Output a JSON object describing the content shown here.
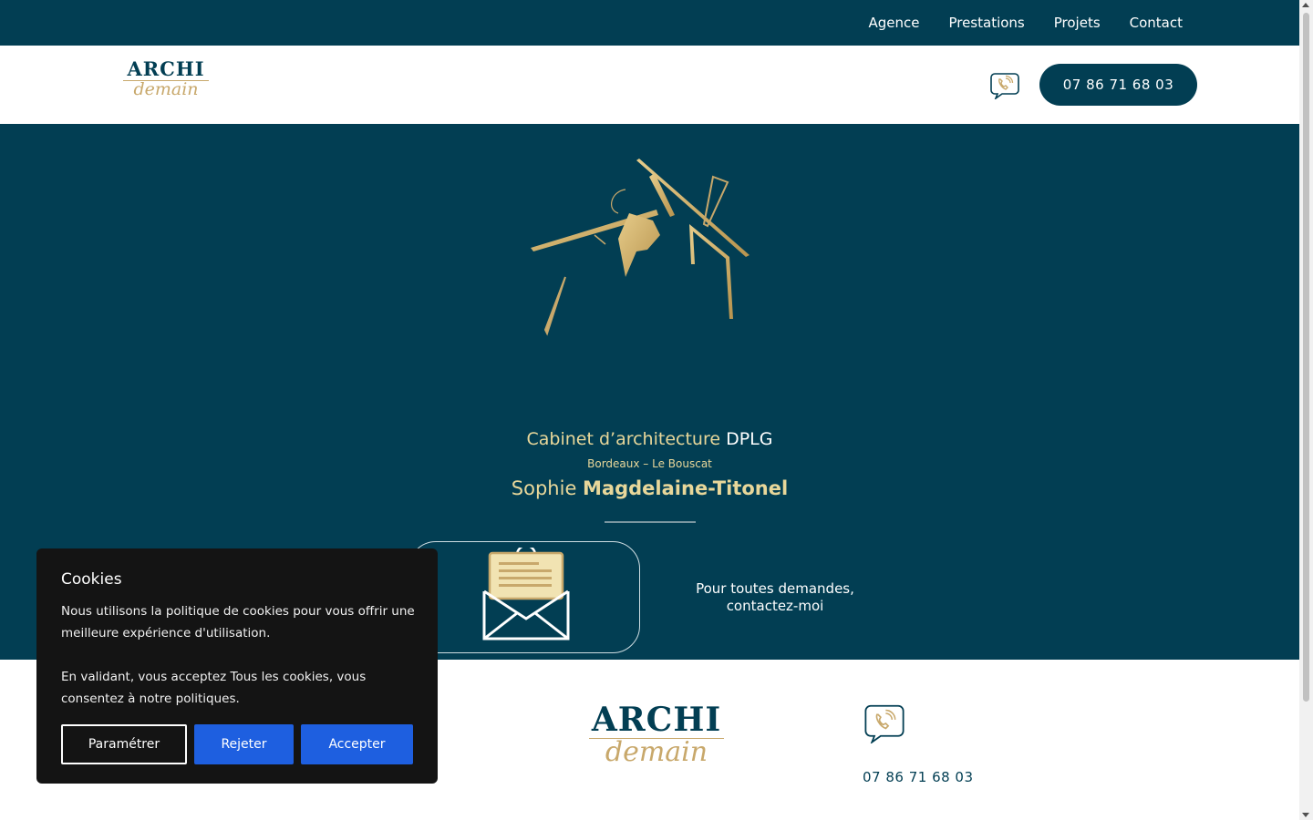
{
  "nav": {
    "items": [
      "Agence",
      "Prestations",
      "Projets",
      "Contact"
    ]
  },
  "header": {
    "logo_archi": "ARCHI",
    "logo_demain": "demain",
    "phone_icon": "phone-bubble-icon",
    "phone_button": "07 86 71 68 03"
  },
  "hero": {
    "title_main": "Cabinet d’architecture ",
    "title_accent": "DPLG",
    "subtitle": "Bordeaux – Le Bouscat",
    "name_first": "Sophie ",
    "name_last": "Magdelaine-Titonel",
    "mail_icon": "envelope-letter-icon",
    "contact_line1": "Pour toutes demandes,",
    "contact_line2": "contactez-moi"
  },
  "footer": {
    "logo_archi": "ARCHI",
    "logo_demain": "demain",
    "phone_icon": "phone-bubble-icon",
    "phone": "07 86 71 68 03"
  },
  "cookie": {
    "title": "Cookies",
    "text1": "Nous utilisons la politique de cookies pour vous offrir une meilleure expérience d'utilisation.",
    "text2": "En validant, vous acceptez Tous les cookies, vous consentez à notre politiques.",
    "btn_settings": "Paramétrer",
    "btn_reject": "Rejeter",
    "btn_accept": "Accepter"
  },
  "colors": {
    "primary": "#023e53",
    "gold": "#c8a86b",
    "gold_text": "#e8d79a",
    "cookie_bg": "#141414",
    "cookie_btn": "#1e5fe0"
  }
}
